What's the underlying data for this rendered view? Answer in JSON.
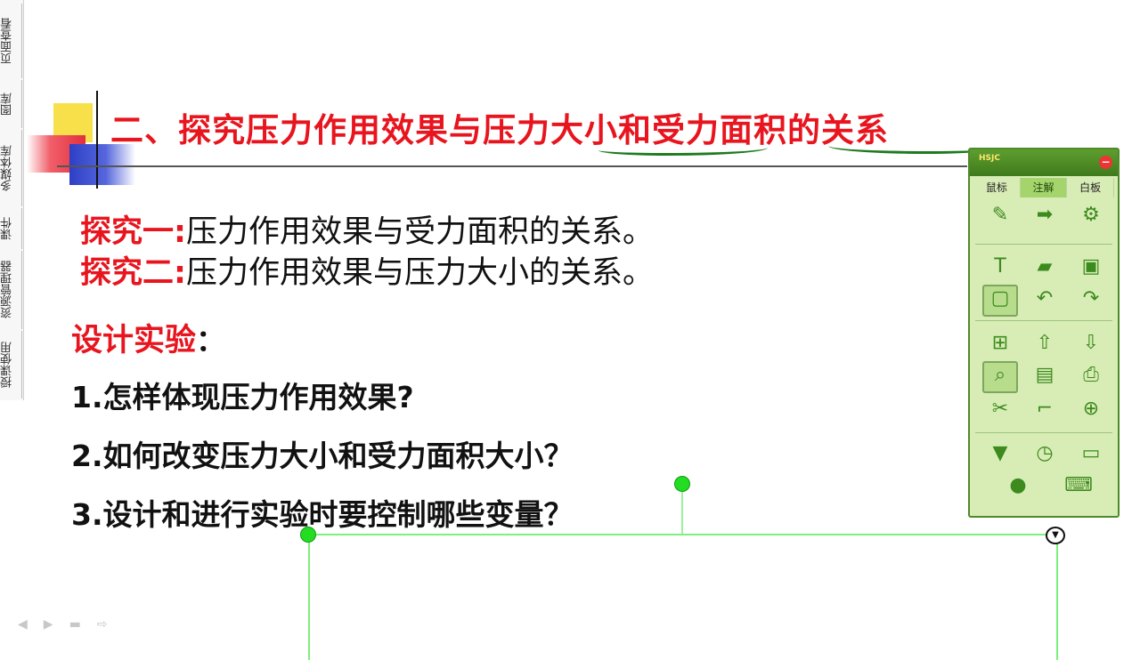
{
  "side_tabs": [
    "授课使用",
    "资源管理器",
    "课件",
    "多媒体库",
    "图库",
    "页面查看"
  ],
  "slide_nav": [
    "◀",
    "▶",
    "▬",
    "⇨"
  ],
  "title": "二、探究压力作用效果与压力大小和受力面积的关系",
  "explore1": {
    "label": "探究一:",
    "text": "压力作用效果与受力面积的关系。"
  },
  "explore2": {
    "label": "探究二:",
    "text": "压力作用效果与压力大小的关系。"
  },
  "design": {
    "label": "设计实验",
    "colon": "："
  },
  "questions": [
    "1.怎样体现压力作用效果?",
    "2.如何改变压力大小和受力面积大小？",
    "3.设计和进行实验时要控制哪些变量？"
  ],
  "toolbar": {
    "logo": "HSJC",
    "close": "−",
    "tabs": [
      "鼠标",
      "注解",
      "白板"
    ],
    "active_tab": 1,
    "icons": [
      "pens-icon",
      "arrow-icon",
      "gear-icon",
      "text-icon",
      "eraser-icon",
      "image-insert-icon",
      "select-rect-icon",
      "undo-icon",
      "redo-icon",
      "new-page-icon",
      "page-up-icon",
      "page-down-icon",
      "zoom-page-icon",
      "screenshot-icon",
      "print-icon",
      "tools-icon",
      "spotlight-icon",
      "add-icon",
      "filter-icon",
      "timer-icon",
      "camera-icon",
      "users-icon",
      "keyboard-icon"
    ]
  },
  "colors": {
    "title": "#e8141e",
    "panel_bg": "#d8edb6",
    "panel_border": "#4f8a2a",
    "selection": "#7ef07e"
  }
}
